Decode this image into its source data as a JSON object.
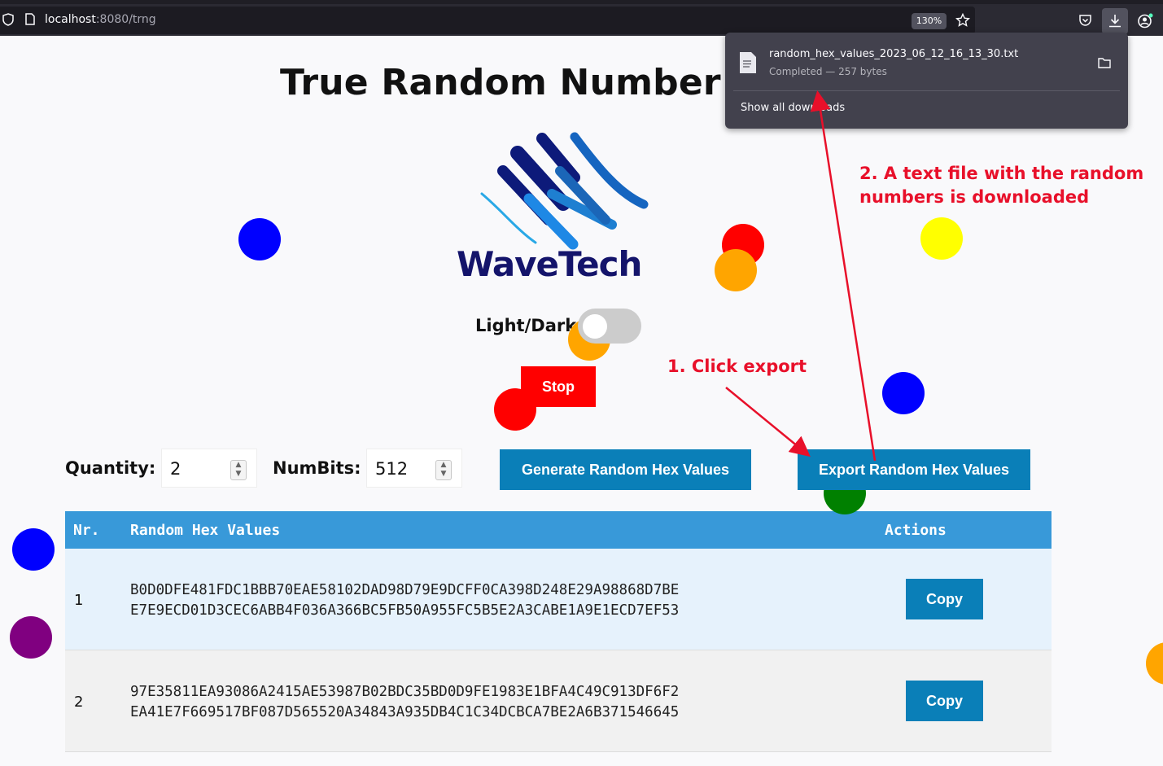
{
  "browser": {
    "url_host": "localhost",
    "url_path": ":8080/trng",
    "zoom": "130%"
  },
  "downloads": {
    "filename": "random_hex_values_2023_06_12_16_13_30.txt",
    "status": "Completed — 257 bytes",
    "show_all": "Show all downloads"
  },
  "page": {
    "title": "True Random Number Gen",
    "logo_text": "WaveTech",
    "theme_label": "Light/Dark",
    "stop_label": "Stop",
    "quantity_label": "Quantity:",
    "quantity_value": "2",
    "numbits_label": "NumBits:",
    "numbits_value": "512",
    "generate_label": "Generate Random Hex Values",
    "export_label": "Export Random Hex Values"
  },
  "table": {
    "headers": [
      "Nr.",
      "Random Hex Values",
      "Actions"
    ],
    "rows": [
      {
        "nr": "1",
        "line1": "B0D0DFE481FDC1BBB70EAE58102DAD98D79E9DCFF0CA398D248E29A98868D7BE",
        "line2": "E7E9ECD01D3CEC6ABB4F036A366BC5FB50A955FC5B5E2A3CABE1A9E1ECD7EF53",
        "action": "Copy"
      },
      {
        "nr": "2",
        "line1": "97E35811EA93086A2415AE53987B02BDC35BD0D9FE1983E1BFA4C49C913DF6F2",
        "line2": "EA41E7F669517BF087D565520A34843A935DB4C1C34DCBCA7BE2A6B371546645",
        "action": "Copy"
      }
    ]
  },
  "annotations": {
    "step1": "1. Click export",
    "step2_line1": "2. A text file with the random",
    "step2_line2": "numbers is downloaded"
  },
  "colors": {
    "annotation": "#e8102a",
    "primary_button": "#0a7fb8",
    "table_header": "#3899d9",
    "stop_button": "#ff0000"
  }
}
